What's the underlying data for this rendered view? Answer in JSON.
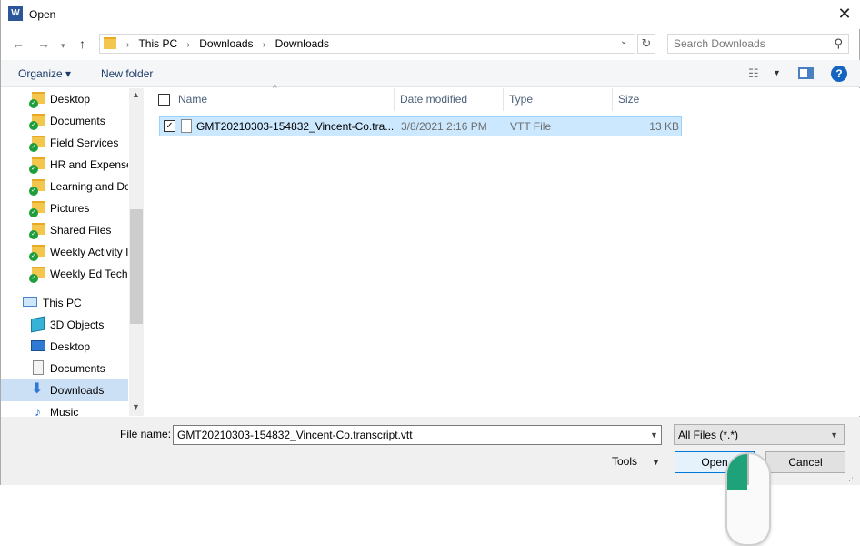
{
  "window": {
    "title": "Open",
    "app_icon": "W",
    "close_glyph": "✕"
  },
  "nav": {
    "back_glyph": "←",
    "forward_glyph": "→",
    "recent_glyph": "▾",
    "up_glyph": "↑",
    "breadcrumbs": [
      "This PC",
      "Downloads",
      "Downloads"
    ],
    "breadcrumb_separator": "›",
    "dropdown_glyph": "⌄",
    "refresh_glyph": "↻",
    "search_placeholder": "Search Downloads",
    "search_glyph": "⚲"
  },
  "toolbar": {
    "organize_label": "Organize ▾",
    "new_folder_label": "New folder",
    "view_glyph": "☷",
    "view_drop_glyph": "▼",
    "help_glyph": "?"
  },
  "sidebar": {
    "items": [
      {
        "label": "Desktop",
        "icon": "folder-sync"
      },
      {
        "label": "Documents",
        "icon": "folder-sync"
      },
      {
        "label": "Field Services",
        "icon": "folder-sync"
      },
      {
        "label": "HR and Expense",
        "icon": "folder-sync"
      },
      {
        "label": "Learning and De",
        "icon": "folder-sync"
      },
      {
        "label": "Pictures",
        "icon": "folder-sync"
      },
      {
        "label": "Shared Files",
        "icon": "folder-sync"
      },
      {
        "label": "Weekly Activity I",
        "icon": "folder-sync"
      },
      {
        "label": "Weekly Ed Tech",
        "icon": "folder-sync"
      },
      {
        "label": "This PC",
        "icon": "computer"
      },
      {
        "label": "3D Objects",
        "icon": "cube"
      },
      {
        "label": "Desktop",
        "icon": "desktop"
      },
      {
        "label": "Documents",
        "icon": "documents"
      },
      {
        "label": "Downloads",
        "icon": "downloads",
        "selected": true
      },
      {
        "label": "Music",
        "icon": "music"
      }
    ],
    "check_glyph": "✓",
    "scroll_up_glyph": "▲",
    "scroll_down_glyph": "▼"
  },
  "filelist": {
    "columns": [
      "Name",
      "Date modified",
      "Type",
      "Size"
    ],
    "sort_glyph": "^",
    "rows": [
      {
        "name": "GMT20210303-154832_Vincent-Co.tra...",
        "date": "3/8/2021 2:16 PM",
        "type": "VTT File",
        "size": "13 KB",
        "checked_glyph": "✓"
      }
    ]
  },
  "bottom": {
    "filename_label": "File name:",
    "filename_value": "GMT20210303-154832_Vincent-Co.transcript.vtt",
    "filename_drop_glyph": "▼",
    "filter_value": "All Files (*.*)",
    "filter_drop_glyph": "▼",
    "tools_label": "Tools",
    "tools_drop_glyph": "▼",
    "open_label": "Open",
    "cancel_label": "Cancel",
    "grip_glyph": "⋰"
  },
  "colors": {
    "accent": "#0078d7",
    "selection": "#cce8ff",
    "folder": "#f3c64e",
    "sync": "#1e9e3c",
    "mouse_button": "#1fa27a"
  }
}
